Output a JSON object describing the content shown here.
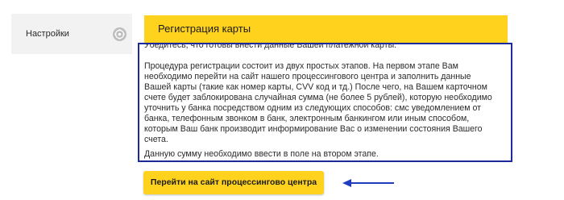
{
  "sidebar": {
    "item_label": "Настройки",
    "icon": "gear-icon"
  },
  "card": {
    "title": "Регистрация карты"
  },
  "info": {
    "lines": [
      "Убедитесь, что готовы внести данные Вашей платежной карты.",
      "",
      "Процедура регистрации состоит из двух простых этапов. На первом этапе Вам",
      "необходимо перейти на сайт нашего процессингового центра и заполнить данные",
      "Вашей карты (такие как номер карты, CVV код и тд.) После чего, на Вашем карточном",
      "счете будет заблокирована случайная сумма (не более 5 рублей), которую необходимо",
      "уточнить у банка посредством одним из следующих способов: смс уведомлением от",
      "банка, телефонным звонком в банк, электронным банкингом или иным способом,",
      "которым Ваш банк производит информирование Вас о изменении состояния Вашего",
      "счета.",
      "Данную сумму необходимо ввести в поле на втором этапе."
    ]
  },
  "button": {
    "label": "Перейти на сайт процессингово центра"
  },
  "colors": {
    "accent_yellow": "#ffd21e",
    "box_border_blue": "#1c2a9e",
    "arrow_blue": "#1f3dbf",
    "sidebar_bg": "#f2f2f2"
  },
  "icons": {
    "annotation": "arrow-left-icon"
  }
}
